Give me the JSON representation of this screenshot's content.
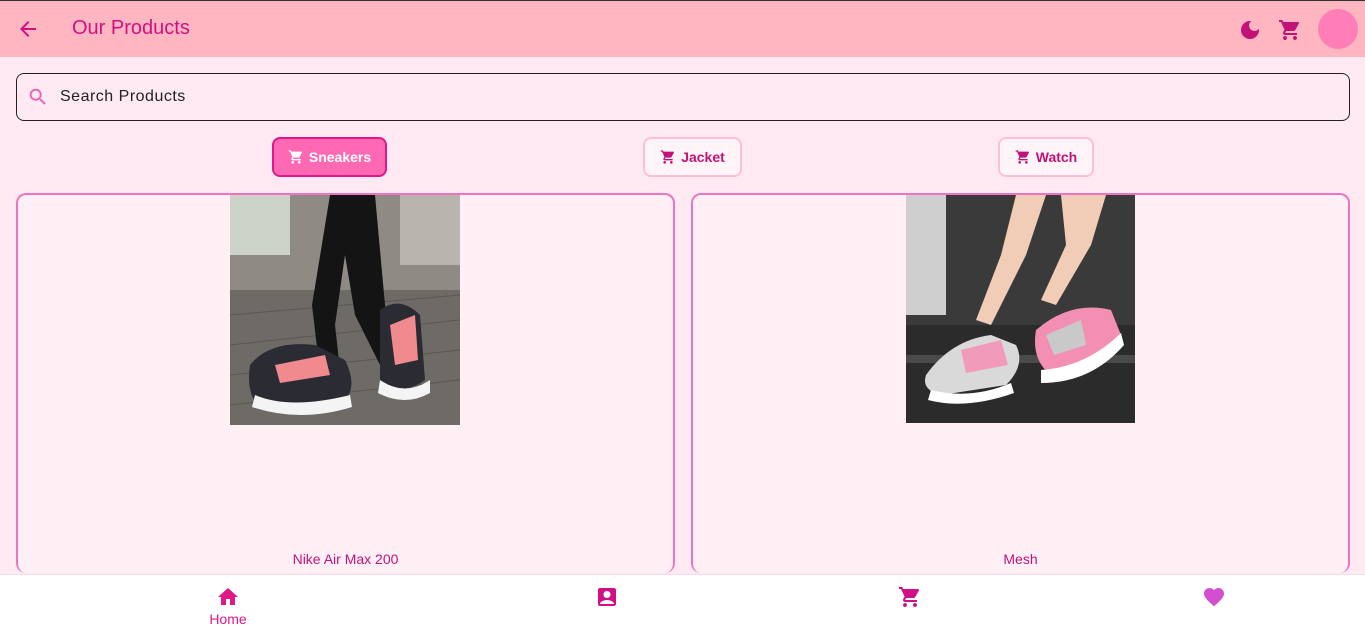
{
  "header": {
    "title": "Our Products"
  },
  "search": {
    "placeholder": "Search Products"
  },
  "categories": [
    {
      "label": "Sneakers",
      "active": true
    },
    {
      "label": "Jacket",
      "active": false
    },
    {
      "label": "Watch",
      "active": false
    }
  ],
  "products": [
    {
      "name": "Nike Air Max 200"
    },
    {
      "name": "Mesh"
    }
  ],
  "bottom_nav": {
    "home_label": "Home"
  },
  "colors": {
    "appbar": "#ffb6c1",
    "accent": "#e0188a",
    "background": "#ffeaf3"
  }
}
